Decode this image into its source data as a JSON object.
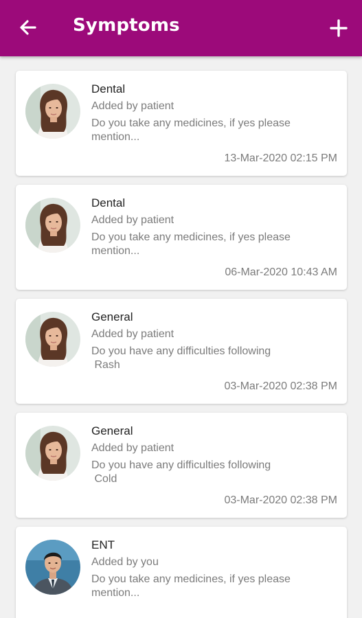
{
  "header": {
    "title": "Symptoms",
    "back_icon": "arrow-left-icon",
    "add_icon": "plus-icon",
    "color": "#9c0a7a"
  },
  "symptoms": [
    {
      "category": "Dental",
      "added_by": "Added by patient",
      "question_line1": "Do you take any medicines, if yes please",
      "question_line2": "mention...",
      "datetime": "13-Mar-2020 02:15 PM",
      "avatar": "female-doctor-avatar"
    },
    {
      "category": "Dental",
      "added_by": "Added by patient",
      "question_line1": "Do you take any medicines, if yes please",
      "question_line2": "mention...",
      "datetime": "06-Mar-2020 10:43 AM",
      "avatar": "female-doctor-avatar"
    },
    {
      "category": "General",
      "added_by": "Added by patient",
      "question_line1": "Do you have any difficulties following",
      "question_line2": " Rash",
      "datetime": "03-Mar-2020 02:38 PM",
      "avatar": "female-doctor-avatar"
    },
    {
      "category": "General",
      "added_by": "Added by patient",
      "question_line1": "Do you have any difficulties following",
      "question_line2": " Cold",
      "datetime": "03-Mar-2020 02:38 PM",
      "avatar": "female-doctor-avatar"
    },
    {
      "category": "ENT",
      "added_by": "Added by you",
      "question_line1": "Do you take any medicines, if yes please",
      "question_line2": "mention...",
      "datetime": "",
      "avatar": "male-user-avatar"
    }
  ]
}
